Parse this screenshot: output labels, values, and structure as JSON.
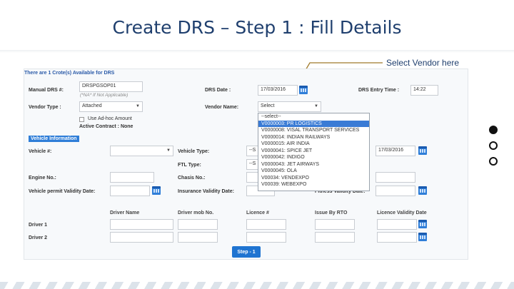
{
  "slide": {
    "title": "Create DRS – Step 1 : Fill Details",
    "callout": "Select Vendor here"
  },
  "form": {
    "notice": "There are 1 Crote(s) Available for DRS",
    "manual_drs_label": "Manual DRS #:",
    "manual_drs_value": "DRSPGSOP01",
    "manual_drs_hint": "(*NA* If Not Applicable)",
    "drs_date_label": "DRS Date :",
    "drs_date_value": "17/03/2016",
    "drs_entry_time_label": "DRS Entry Time :",
    "drs_entry_time_value": "14:22",
    "vendor_type_label": "Vendor Type :",
    "vendor_type_value": "Attached",
    "vendor_name_label": "Vendor Name:",
    "vendor_name_value": "Select",
    "adhoc_label": "Use Ad-hoc Amount",
    "active_contract_label": "Active Contract : None",
    "vehicle_section": "Vehicle Information",
    "vehicle_no_label": "Vehicle #:",
    "vehicle_type_label": "Vehicle Type:",
    "vehicle_type_value": "--S",
    "ftl_type_label": "FTL Type:",
    "ftl_type_value": "--S",
    "right_date_value": "17/03/2016",
    "engine_no_label": "Engine No.:",
    "chasis_no_label": "Chasis No.:",
    "permit_validity_label": "Vehicle permit Validity Date:",
    "insurance_validity_label": "Insurance Validity Date:",
    "fitness_validity_label": "Fitness Validity Date:",
    "driver_headers": [
      "Driver Name",
      "Driver mob No.",
      "Licence #",
      "Issue By RTO",
      "Licence Validity Date"
    ],
    "driver1_label": "Driver 1",
    "driver2_label": "Driver 2",
    "step_button": "Step - 1"
  },
  "vendor_dropdown": {
    "items": [
      "--select--",
      "V0000003: PR LOGISTICS",
      "V0000008: VISAL TRANSPORT SERVICES",
      "V0000014: INDIAN RAILWAYS",
      "V0000015: AIR INDIA",
      "V0000041: SPICE JET",
      "V0000042: INDIGO",
      "V0000043: JET AIRWAYS",
      "V0000045: OLA",
      "V00034: VENDEXPO",
      "V00039: WEBEXPO"
    ],
    "selected_index": 1
  },
  "colors": {
    "accent": "#2f7ed8",
    "title": "#1f3f6e",
    "callout_line": "#a07a2a"
  }
}
